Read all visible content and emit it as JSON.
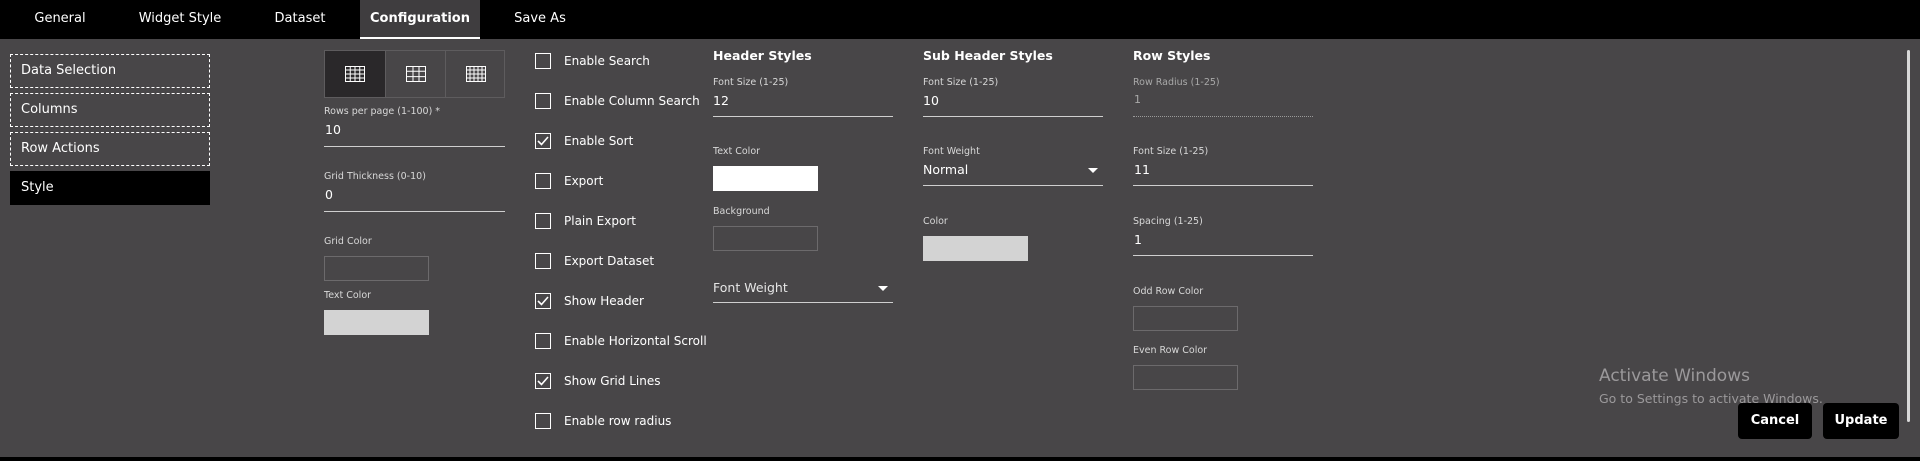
{
  "tabs": [
    {
      "label": "General"
    },
    {
      "label": "Widget Style"
    },
    {
      "label": "Dataset"
    },
    {
      "label": "Configuration",
      "active": true
    },
    {
      "label": "Save As"
    }
  ],
  "sidebar": {
    "items": [
      {
        "label": "Data Selection"
      },
      {
        "label": "Columns"
      },
      {
        "label": "Row Actions"
      },
      {
        "label": "Style",
        "active": true
      }
    ]
  },
  "grid_options": {
    "selected": "full-grid",
    "options": [
      "full-grid-icon",
      "inner-grid-icon",
      "dense-grid-icon"
    ]
  },
  "general": {
    "rows_per_page_label": "Rows per page (1-100) *",
    "rows_per_page_value": "10",
    "grid_thickness_label": "Grid Thickness (0-10)",
    "grid_thickness_value": "0",
    "grid_color_label": "Grid Color",
    "text_color_label": "Text Color"
  },
  "checkboxes": [
    {
      "label": "Enable Search",
      "checked": false
    },
    {
      "label": "Enable Column Search",
      "checked": false
    },
    {
      "label": "Enable Sort",
      "checked": true
    },
    {
      "label": "Export",
      "checked": false
    },
    {
      "label": "Plain Export",
      "checked": false
    },
    {
      "label": "Export Dataset",
      "checked": false
    },
    {
      "label": "Show Header",
      "checked": true
    },
    {
      "label": "Enable Horizontal Scroll",
      "checked": false
    },
    {
      "label": "Show Grid Lines",
      "checked": true
    },
    {
      "label": "Enable row radius",
      "checked": false
    }
  ],
  "header_styles": {
    "title": "Header Styles",
    "font_size_label": "Font Size (1-25)",
    "font_size_value": "12",
    "text_color_label": "Text Color",
    "background_label": "Background",
    "font_weight_placeholder": "Font Weight"
  },
  "sub_header_styles": {
    "title": "Sub Header Styles",
    "font_size_label": "Font Size (1-25)",
    "font_size_value": "10",
    "font_weight_label": "Font Weight",
    "font_weight_value": "Normal",
    "color_label": "Color"
  },
  "row_styles": {
    "title": "Row Styles",
    "row_radius_label": "Row Radius (1-25)",
    "row_radius_value": "1",
    "font_size_label": "Font Size (1-25)",
    "font_size_value": "11",
    "spacing_label": "Spacing (1-25)",
    "spacing_value": "1",
    "odd_row_color_label": "Odd Row Color",
    "even_row_color_label": "Even Row Color"
  },
  "watermark": {
    "title": "Activate Windows",
    "subtitle": "Go to Settings to activate Windows."
  },
  "actions": {
    "cancel_label": "Cancel",
    "update_label": "Update"
  },
  "colors": {
    "panel": "#484648",
    "topbar": "#000000",
    "swatch_white": "#ffffff",
    "swatch_light": "#d3d3d3"
  }
}
